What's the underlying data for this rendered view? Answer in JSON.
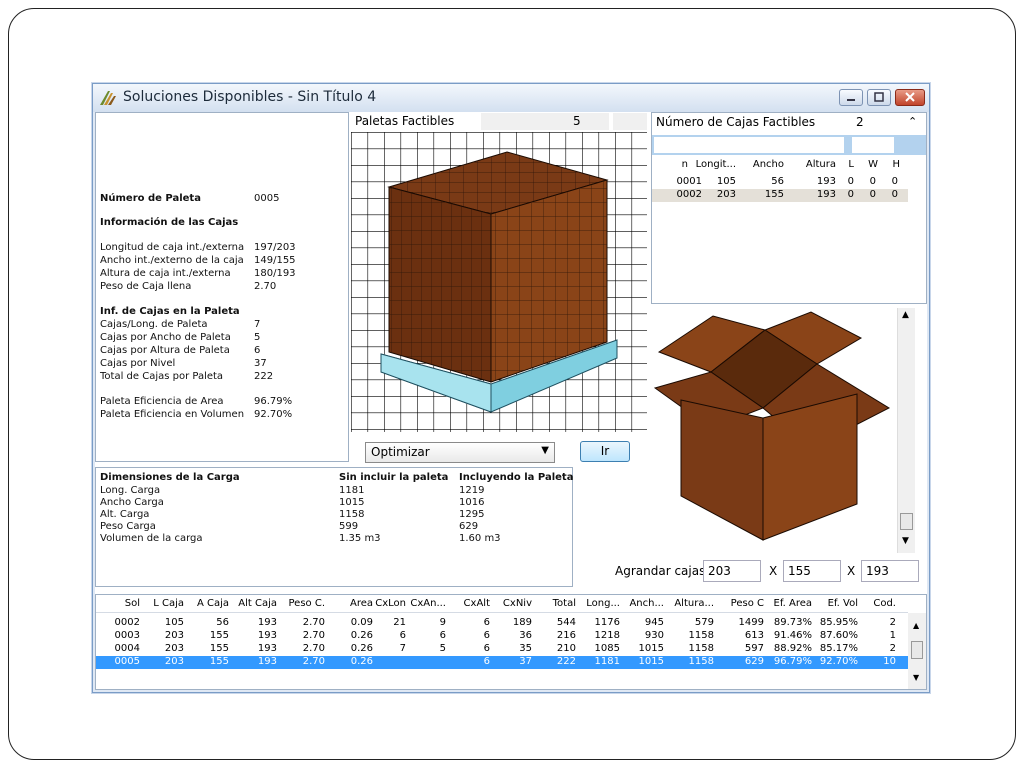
{
  "window": {
    "title": "Soluciones Disponibles - Sin Título 4"
  },
  "info": {
    "numero_paleta_label": "Número de Paleta",
    "numero_paleta_value": "0005",
    "info_cajas_title": "Información de las Cajas",
    "rows1": [
      {
        "label": "Longitud de caja int./externa",
        "value": "197/203"
      },
      {
        "label": "Ancho int./externo de la caja",
        "value": "149/155"
      },
      {
        "label": "Altura de caja int./externa",
        "value": "180/193"
      },
      {
        "label": "Peso de Caja llena",
        "value": "2.70"
      }
    ],
    "inf_cajas_title": "Inf. de Cajas en la Paleta",
    "rows2": [
      {
        "label": "Cajas/Long. de Paleta",
        "value": "7"
      },
      {
        "label": "Cajas por Ancho de Paleta",
        "value": "5"
      },
      {
        "label": "Cajas por Altura de Paleta",
        "value": "6"
      },
      {
        "label": "Cajas por Nivel",
        "value": "37"
      },
      {
        "label": "Total de Cajas por Paleta",
        "value": "222"
      }
    ],
    "rows3": [
      {
        "label": "Paleta Eficiencia de Area",
        "value": "96.79%"
      },
      {
        "label": "Paleta Eficiencia en Volumen",
        "value": "92.70%"
      }
    ]
  },
  "paletas": {
    "label": "Paletas Factibles",
    "count": "5"
  },
  "optimizar": {
    "selected": "Optimizar",
    "go_label": "Ir"
  },
  "carga": {
    "title": "Dimensiones de la Carga",
    "col1": "Sin incluir la paleta",
    "col2": "Incluyendo la Paleta",
    "rows": [
      {
        "label": "Long. Carga",
        "v1": "1181",
        "v2": "1219"
      },
      {
        "label": "Ancho Carga",
        "v1": "1015",
        "v2": "1016"
      },
      {
        "label": "Alt. Carga",
        "v1": "1158",
        "v2": "1295"
      },
      {
        "label": "Peso Carga",
        "v1": "599",
        "v2": "629"
      },
      {
        "label": "Volumen de la carga",
        "v1": "1.35 m3",
        "v2": "1.60 m3"
      }
    ]
  },
  "cajas_factibles": {
    "label": "Número de Cajas Factibles",
    "count": "2",
    "headers": [
      "n",
      "Longit...",
      "Ancho",
      "Altura",
      "L",
      "W",
      "H"
    ],
    "rows": [
      [
        "0001",
        "105",
        "56",
        "193",
        "0",
        "0",
        "0"
      ],
      [
        "0002",
        "203",
        "155",
        "193",
        "0",
        "0",
        "0"
      ]
    ]
  },
  "agrandar": {
    "label": "Agrandar cajas",
    "x": "X",
    "v1": "203",
    "v2": "155",
    "v3": "193"
  },
  "solutions": {
    "headers": [
      "Sol",
      "L Caja",
      "A Caja",
      "Alt Caja",
      "Peso C.",
      "Area",
      "CxLon",
      "CxAn...",
      "CxAlt",
      "CxNiv",
      "Total",
      "Long...",
      "Anch...",
      "Altura...",
      "Peso C",
      "Ef. Area",
      "Ef. Vol",
      "Cod."
    ],
    "rows": [
      [
        "0002",
        "105",
        "56",
        "193",
        "2.70",
        "0.09",
        "21",
        "9",
        "6",
        "189",
        "544",
        "1176",
        "945",
        "579",
        "1499",
        "89.73%",
        "85.95%",
        "2"
      ],
      [
        "0003",
        "203",
        "155",
        "193",
        "2.70",
        "0.26",
        "6",
        "6",
        "6",
        "36",
        "216",
        "1218",
        "930",
        "1158",
        "613",
        "91.46%",
        "87.60%",
        "1"
      ],
      [
        "0004",
        "203",
        "155",
        "193",
        "2.70",
        "0.26",
        "7",
        "5",
        "6",
        "35",
        "210",
        "1085",
        "1015",
        "1158",
        "597",
        "88.92%",
        "85.17%",
        "2"
      ],
      [
        "0005",
        "203",
        "155",
        "193",
        "2.70",
        "0.26",
        "",
        "",
        "6",
        "37",
        "222",
        "1181",
        "1015",
        "1158",
        "629",
        "96.79%",
        "92.70%",
        "10"
      ]
    ]
  }
}
